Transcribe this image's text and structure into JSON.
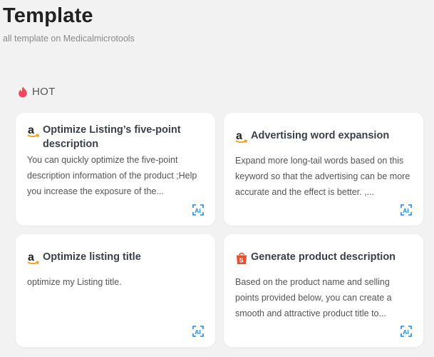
{
  "header": {
    "title": "Template",
    "subtitle": "all template on Medicalmicrotools"
  },
  "section": {
    "title": "HOT",
    "icon": "flame-icon",
    "icon_color": "#f5455c"
  },
  "cards": [
    {
      "brand": "amazon",
      "title": "Optimize Listing’s five-point description",
      "description": "You can quickly optimize the five-point description information of the product ;Help you increase the exposure of the..."
    },
    {
      "brand": "amazon",
      "title": "Advertising word expansion",
      "description": "Expand more long-tail words based on this keyword so that the advertising can be more accurate and the effect is better. ,..."
    },
    {
      "brand": "amazon",
      "title": "Optimize listing title",
      "description": "optimize my Listing title."
    },
    {
      "brand": "shopee",
      "title": "Generate product description",
      "description": "Based on the product name and selling points provided below, you can create a smooth and attractive product title to..."
    }
  ],
  "colors": {
    "background": "#f2f2f3",
    "card": "#ffffff",
    "ai_icon": "#1e88e5",
    "amazon_smile": "#f29b1d",
    "shopee": "#ee4d2d"
  }
}
